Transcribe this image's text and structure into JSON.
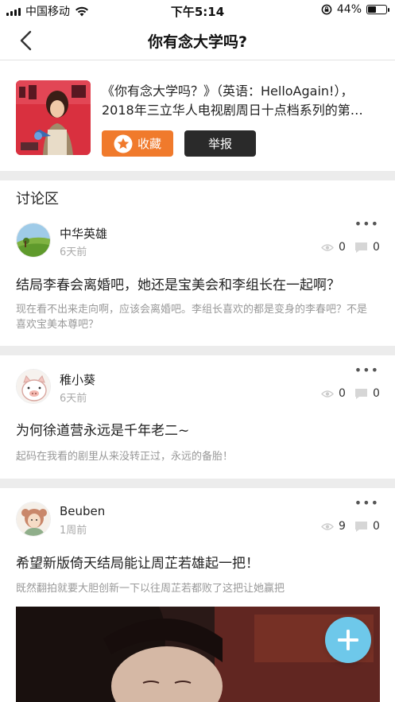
{
  "status_bar": {
    "carrier": "中国移动",
    "time": "下午5:14",
    "battery": "44%",
    "battery_level": 0.44
  },
  "nav": {
    "title": "你有念大学吗?"
  },
  "info": {
    "description": "《你有念大学吗？》（英语：HelloAgain!），2018年三立华人电视剧周日十点档系列的第…",
    "collect_label": "收藏",
    "report_label": "举报"
  },
  "discussion": {
    "title": "讨论区"
  },
  "posts": [
    {
      "username": "中华英雄",
      "time": "6天前",
      "views": "0",
      "comments": "0",
      "title": "结局李春会离婚吧，她还是宝美会和李组长在一起啊？",
      "body": "现在看不出来走向啊，应该会离婚吧。李组长喜欢的都是变身的李春吧？不是喜欢宝美本尊吧？"
    },
    {
      "username": "稚小葵",
      "time": "6天前",
      "views": "0",
      "comments": "0",
      "title": "为何徐道营永远是千年老二~",
      "body": "起码在我看的剧里从来没转正过，永远的备胎！"
    },
    {
      "username": "Beuben",
      "time": "1周前",
      "views": "9",
      "comments": "0",
      "title": "希望新版倚天结局能让周芷若雄起一把！",
      "body": "既然翻拍就要大胆创新一下以往周芷若都败了这把让她赢把"
    }
  ],
  "icons": {
    "back": "chevron-left-icon",
    "star": "star-icon",
    "view": "eye-icon",
    "comment": "comment-icon",
    "more": "more-icon",
    "add": "plus-icon"
  },
  "colors": {
    "accent": "#f07a2c",
    "dark_button": "#2a2a2a",
    "fab": "#6ec8ea",
    "divider": "#ececec"
  }
}
